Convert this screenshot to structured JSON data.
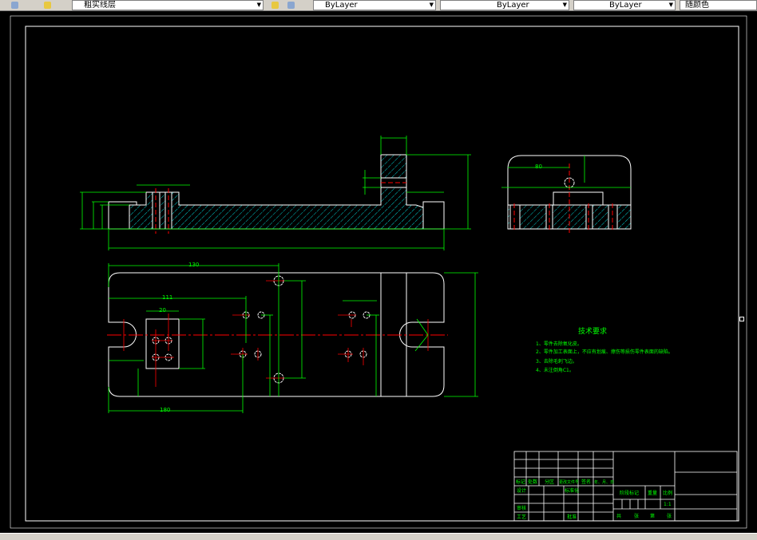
{
  "toolbar": {
    "layer_combo": "粗实线层",
    "color_combo": "ByLayer",
    "linetype_combo": "ByLayer",
    "lineweight_combo": "ByLayer",
    "plotstyle_combo": "随颜色"
  },
  "drawing": {
    "colors": {
      "background": "#000000",
      "outline": "#ffffff",
      "dimension": "#00ff00",
      "centerline": "#ff0000",
      "hatch": "#00ffff"
    },
    "dimensions": {
      "plan_width": "130",
      "plan_111": "111",
      "plan_180": "180",
      "plan_20": "20",
      "side_80": "80"
    },
    "tech_requirements": {
      "title": "技术要求",
      "lines": [
        "1、零件去除氧化皮。",
        "2、零件加工表面上，不应有划痕、擦伤等损伤零件表面的缺陷。",
        "3、去除毛刺飞边。",
        "4、未注倒角C1。"
      ]
    },
    "title_block": {
      "mark": "标记",
      "count": "处数",
      "zone": "分区",
      "change_doc": "更改文件号",
      "signature": "签名",
      "date": "年、月、日",
      "design": "设计",
      "standardization": "标准化",
      "review": "审核",
      "process": "工艺",
      "approve": "批准",
      "stage_mark": "阶段标记",
      "weight": "重量",
      "scale": "比例",
      "scale_value": "1:1",
      "total": "共",
      "sheets1": "张",
      "no": "第",
      "sheets2": "张"
    }
  }
}
